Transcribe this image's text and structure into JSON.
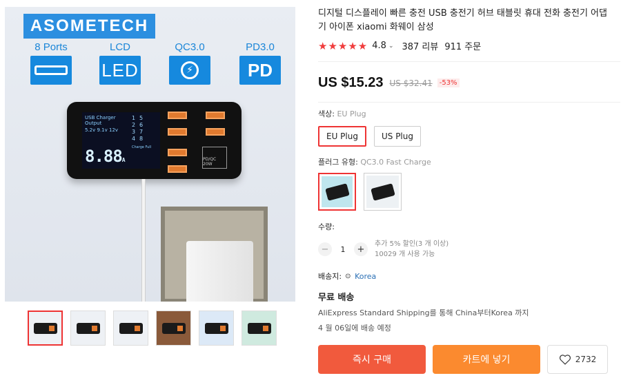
{
  "gallery": {
    "brand": "ASOMETECH",
    "features": [
      {
        "label": "8 Ports",
        "icon": "usb-port-icon"
      },
      {
        "label": "LCD",
        "icon": "led-icon",
        "icon_text": "LED"
      },
      {
        "label": "QC3.0",
        "icon": "quick-charge-icon"
      },
      {
        "label": "PD3.0",
        "icon": "pd-icon",
        "icon_text": "PD"
      }
    ],
    "charger_screen": {
      "line1": "USB Charger",
      "line2": "Output",
      "line3": "5.2v 9.1v 12v",
      "grid": [
        "1",
        "5",
        "2",
        "6",
        "3",
        "7",
        "4",
        "8"
      ],
      "charge_label": "Charge Full",
      "big_value": "8.88",
      "unit": "A",
      "pd_label": "PD/QC 20W"
    },
    "thumbnail_count": 6,
    "active_thumbnail": 0
  },
  "product": {
    "title_line1": "디지털 디스플레이 빠른 충전 USB 충전기 허브 태블릿 휴대 전화 충전기 어댑",
    "title_line2": "기 아이폰 xiaomi 화웨이 삼성",
    "stars": "★★★★★",
    "rating": "4.8",
    "reviews": "387 리뷰",
    "orders": "911 주문",
    "price": "US $15.23",
    "original_price": "US $32.41",
    "discount": "-53%"
  },
  "options": {
    "color_label": "색상:",
    "color_value": "EU Plug",
    "colors": [
      "EU Plug",
      "US Plug"
    ],
    "plug_label": "플러그 유형:",
    "plug_value": "QC3.0 Fast Charge",
    "plug_images": 2
  },
  "quantity": {
    "label": "수량:",
    "minus": "−",
    "value": "1",
    "plus": "+",
    "note1": "추가 5% 할인(3 개 이상)",
    "note2": "10029 개 사용 가능"
  },
  "shipping": {
    "label": "배송지:",
    "country": "Korea",
    "free": "무료 배송",
    "method": "AliExpress Standard Shipping를 통해 China부터Korea 까지",
    "eta": "4 월 06일에 배송 예정"
  },
  "actions": {
    "buy": "즉시 구매",
    "cart": "카트에 넣기",
    "wishlist_count": "2732"
  },
  "colors": {
    "accent_red": "#e33333",
    "buy_button": "#f15a3d",
    "cart_button": "#fb8a2f",
    "brand_blue": "#2c8fe0"
  }
}
